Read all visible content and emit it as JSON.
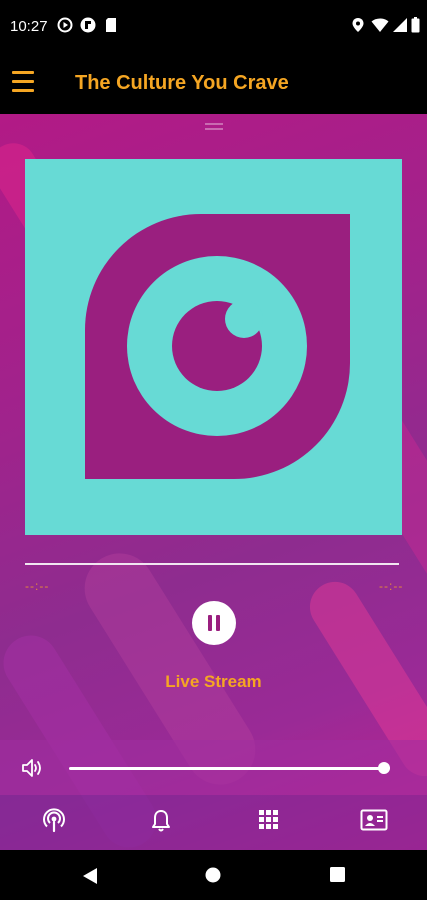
{
  "status_bar": {
    "time": "10:27",
    "left_icons": [
      "play-circle-icon",
      "flipboard-icon",
      "sd-card-icon"
    ],
    "right_icons": [
      "location-icon",
      "wifi-icon",
      "signal-icon",
      "battery-icon"
    ]
  },
  "app_bar": {
    "menu_icon": "hamburger-menu-icon",
    "title": "The Culture You Crave"
  },
  "player": {
    "artwork_icon": "eye-logo-icon",
    "time_elapsed": "--:--",
    "time_total": "--:--",
    "progress": 1.0,
    "control_icon": "pause-icon",
    "stream_label": "Live Stream"
  },
  "volume": {
    "icon": "volume-icon",
    "level": 0.98
  },
  "bottom_nav": {
    "items": [
      "podcast-icon",
      "notification-bell-icon",
      "grid-apps-icon",
      "contact-card-icon"
    ]
  },
  "system_nav": {
    "items": [
      "back-icon",
      "home-icon",
      "recents-icon"
    ]
  },
  "colors": {
    "accent": "#f5a623",
    "artwork_bg": "#67dad5",
    "artwork_fg": "#9a1f7f"
  }
}
